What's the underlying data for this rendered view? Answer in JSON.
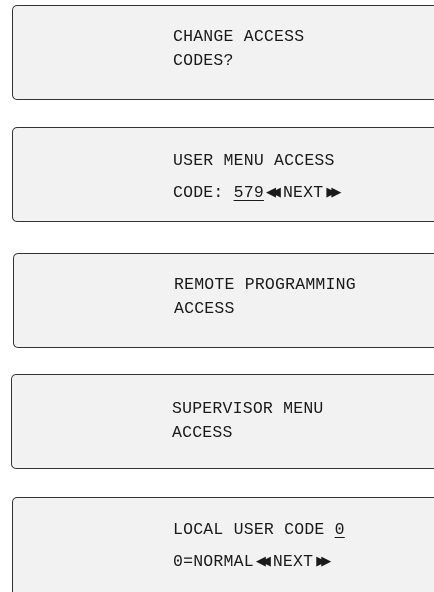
{
  "screens": [
    {
      "line1": "CHANGE ACCESS",
      "line2": "CODES?"
    },
    {
      "line1": "USER MENU ACCESS",
      "line2_prefix": "CODE: ",
      "line2_value": "579",
      "line2_nav": "NEXT",
      "left_arrow_icon": "double-left-triangle-icon",
      "right_arrow_icon": "double-right-triangle-icon"
    },
    {
      "line1": "REMOTE PROGRAMMING",
      "line2": "ACCESS"
    },
    {
      "line1": "SUPERVISOR MENU",
      "line2": "ACCESS"
    },
    {
      "line1_prefix": "LOCAL USER CODE ",
      "line1_value": "0",
      "line2_prefix": "0=NORMAL",
      "line2_nav": "NEXT",
      "left_arrow_icon": "double-left-triangle-icon",
      "right_arrow_icon": "double-right-triangle-icon"
    }
  ]
}
